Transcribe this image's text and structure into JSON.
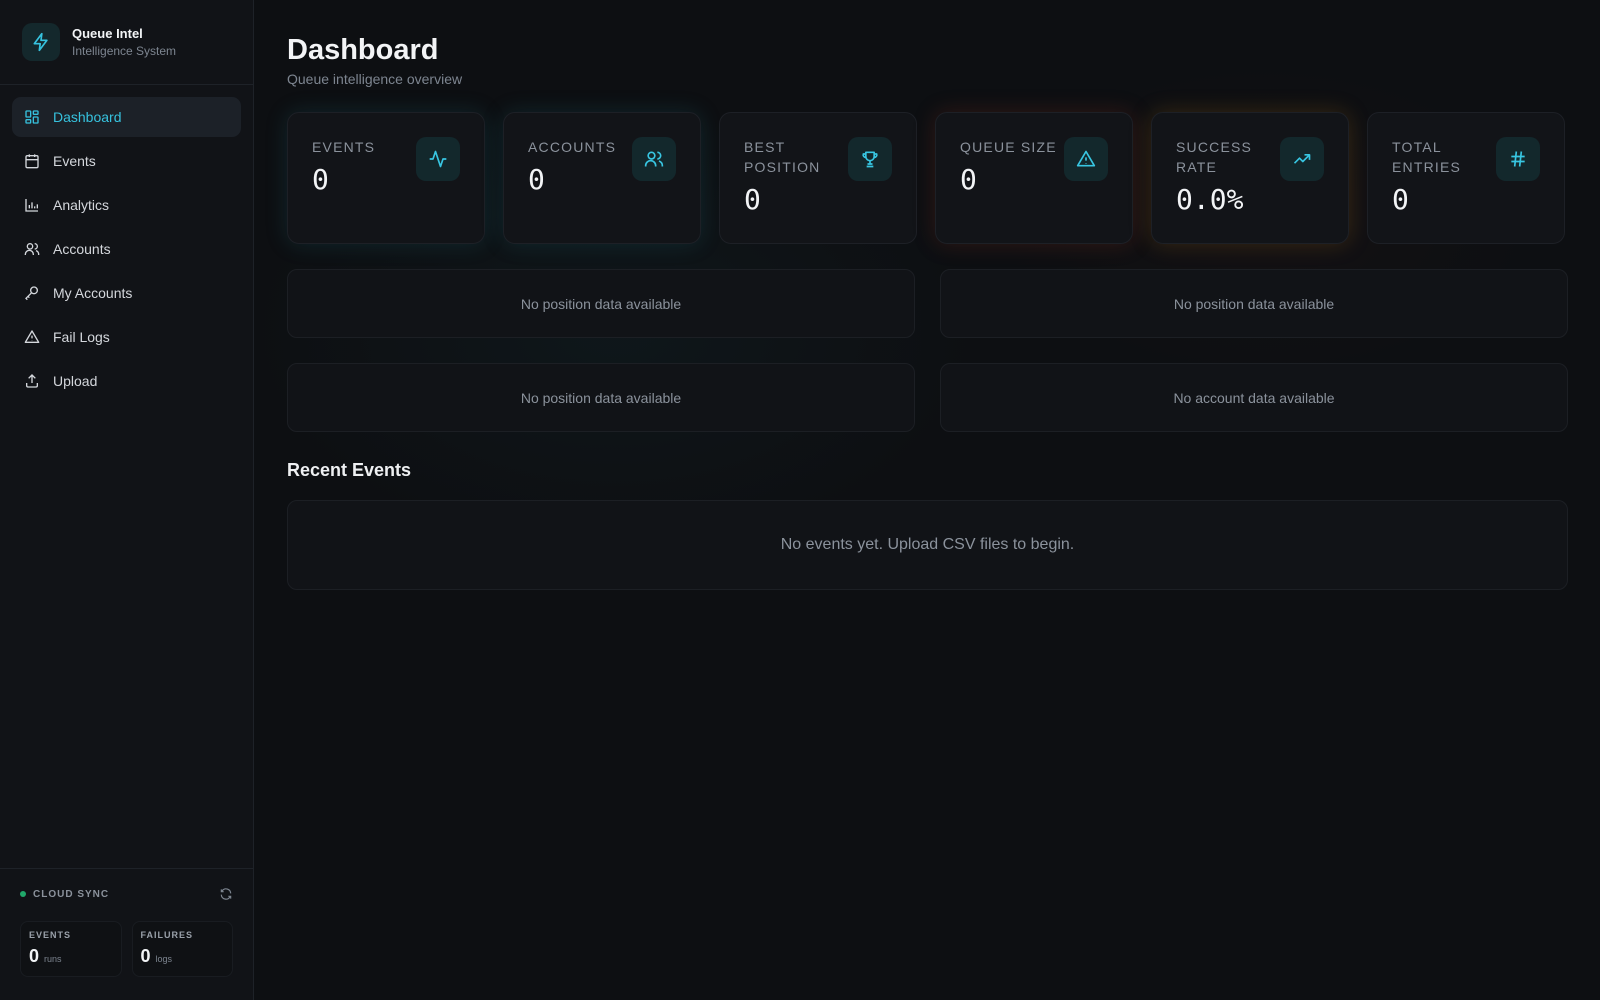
{
  "brand": {
    "title": "Queue Intel",
    "subtitle": "Intelligence System",
    "icon": "lightning-icon"
  },
  "nav": [
    {
      "label": "Dashboard",
      "icon": "grid-icon",
      "active": true
    },
    {
      "label": "Events",
      "icon": "calendar-icon"
    },
    {
      "label": "Analytics",
      "icon": "bar-chart-icon"
    },
    {
      "label": "Accounts",
      "icon": "users-icon"
    },
    {
      "label": "My Accounts",
      "icon": "key-icon"
    },
    {
      "label": "Fail Logs",
      "icon": "warning-icon"
    },
    {
      "label": "Upload",
      "icon": "upload-icon"
    }
  ],
  "sync": {
    "label": "CLOUD SYNC",
    "events": {
      "key": "EVENTS",
      "value": "0",
      "unit": "runs"
    },
    "failures": {
      "key": "FAILURES",
      "value": "0",
      "unit": "logs"
    }
  },
  "header": {
    "title": "Dashboard",
    "subtitle": "Queue intelligence overview"
  },
  "stats": [
    {
      "label": "EVENTS",
      "value": "0",
      "icon": "activity-icon"
    },
    {
      "label": "ACCOUNTS",
      "value": "0",
      "icon": "users-icon"
    },
    {
      "label": "BEST POSITION",
      "value": "0",
      "icon": "trophy-icon"
    },
    {
      "label": "QUEUE SIZE",
      "value": "0",
      "icon": "warning-icon"
    },
    {
      "label": "SUCCESS RATE",
      "value": "0.0%",
      "icon": "trending-up-icon"
    },
    {
      "label": "TOTAL ENTRIES",
      "value": "0",
      "icon": "hash-icon"
    }
  ],
  "panels": [
    "No position data available",
    "No position data available",
    "No position data available",
    "No account data available"
  ],
  "recent_events": {
    "title": "Recent Events",
    "empty": "No events yet. Upload CSV files to begin."
  },
  "colors": {
    "accent": "#36c2de",
    "background": "#0d0f12",
    "sync_dot": "#20a86a"
  }
}
